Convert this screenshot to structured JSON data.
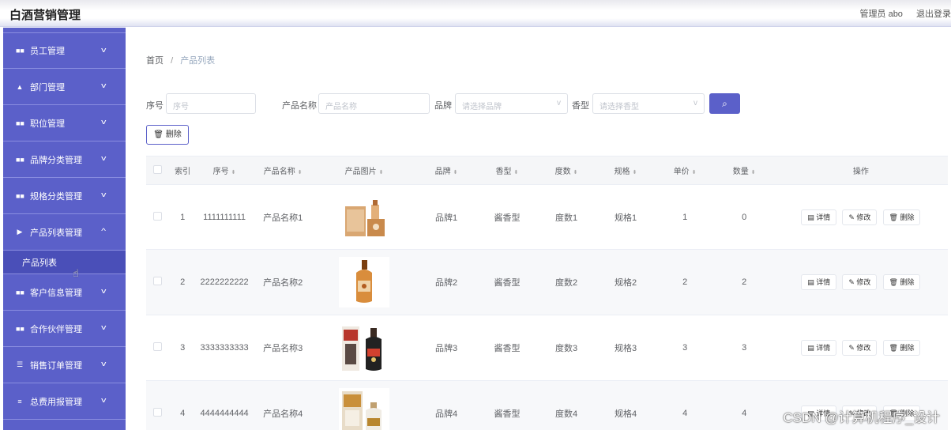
{
  "app": {
    "title": "白酒营销管理"
  },
  "header": {
    "user_label": "管理员 abo",
    "logout": "退出登录"
  },
  "sidebar": {
    "items": [
      {
        "label": "员工管理",
        "icon": "grid-icon"
      },
      {
        "label": "部门管理",
        "icon": "user-icon"
      },
      {
        "label": "职位管理",
        "icon": "grid-icon"
      },
      {
        "label": "品牌分类管理",
        "icon": "grid-icon"
      },
      {
        "label": "规格分类管理",
        "icon": "grid-icon"
      },
      {
        "label": "产品列表管理",
        "icon": "flag-icon",
        "sub": "产品列表"
      },
      {
        "label": "客户信息管理",
        "icon": "grid-icon"
      },
      {
        "label": "合作伙伴管理",
        "icon": "grid-icon"
      },
      {
        "label": "销售订单管理",
        "icon": "list-icon"
      },
      {
        "label": "总费用报管理",
        "icon": "menu-icon"
      }
    ]
  },
  "breadcrumb": {
    "home": "首页",
    "current": "产品列表"
  },
  "search": {
    "no_label": "序号",
    "no_placeholder": "序号",
    "name_label": "产品名称",
    "name_placeholder": "产品名称",
    "brand_label": "品牌",
    "brand_placeholder": "请选择品牌",
    "type_label": "香型",
    "type_placeholder": "请选择香型",
    "search_icon": "search-icon"
  },
  "toolbar": {
    "delete_label": "删除"
  },
  "table": {
    "headers": {
      "index": "索引",
      "no": "序号",
      "name": "产品名称",
      "image": "产品图片",
      "brand": "品牌",
      "type": "香型",
      "degree": "度数",
      "spec": "规格",
      "price": "单价",
      "qty": "数量",
      "ops": "操作"
    },
    "rows": [
      {
        "index": "1",
        "no": "1111111111",
        "name": "产品名称1",
        "brand": "品牌1",
        "type": "酱香型",
        "degree": "度数1",
        "spec": "规格1",
        "price": "1",
        "qty": "0"
      },
      {
        "index": "2",
        "no": "2222222222",
        "name": "产品名称2",
        "brand": "品牌2",
        "type": "酱香型",
        "degree": "度数2",
        "spec": "规格2",
        "price": "2",
        "qty": "2"
      },
      {
        "index": "3",
        "no": "3333333333",
        "name": "产品名称3",
        "brand": "品牌3",
        "type": "酱香型",
        "degree": "度数3",
        "spec": "规格3",
        "price": "3",
        "qty": "3"
      },
      {
        "index": "4",
        "no": "4444444444",
        "name": "产品名称4",
        "brand": "品牌4",
        "type": "酱香型",
        "degree": "度数4",
        "spec": "规格4",
        "price": "4",
        "qty": "4"
      }
    ],
    "ops": {
      "detail": "详情",
      "edit": "修改",
      "delete": "删除"
    }
  },
  "watermark": "CSDN @计算机程序_设计",
  "colors": {
    "accent": "#5b60c9",
    "sidebar": "#5b60c9"
  }
}
